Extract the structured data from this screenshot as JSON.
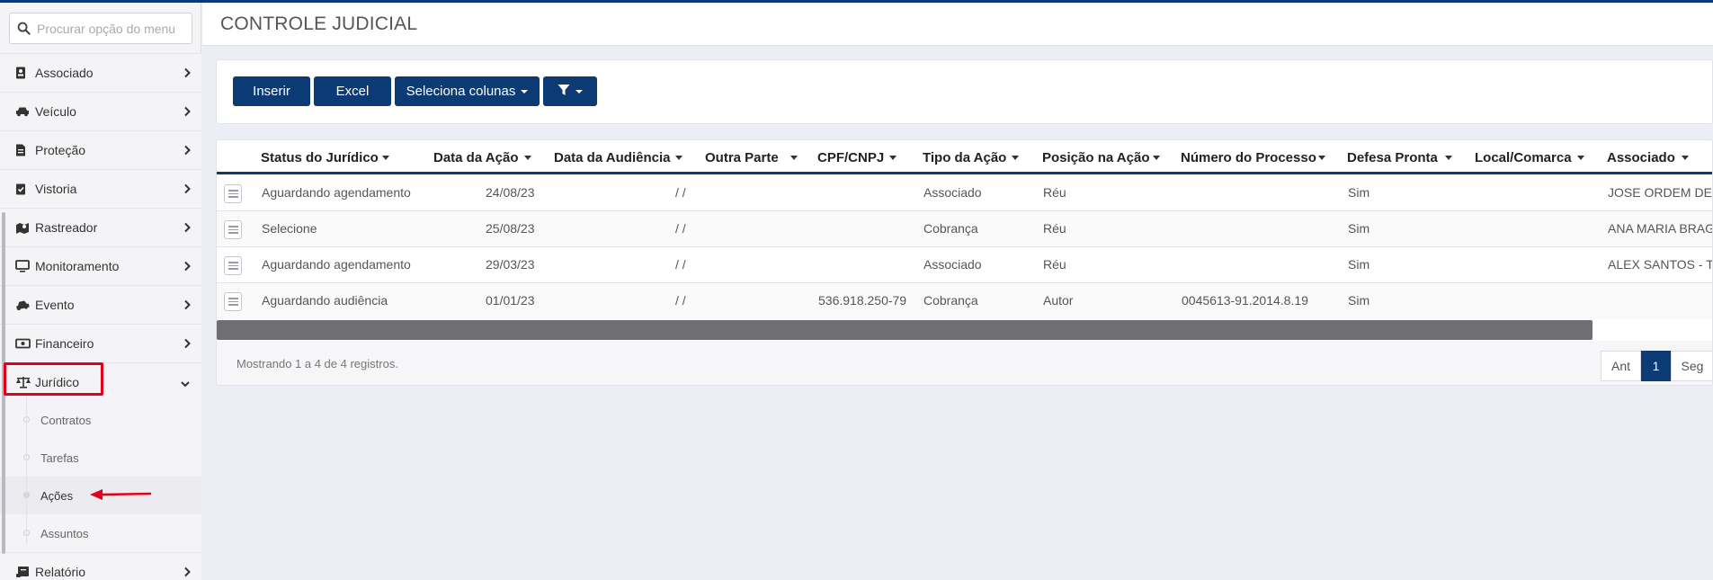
{
  "search": {
    "placeholder": "Procurar opção do menu"
  },
  "sidebar": {
    "items": [
      {
        "label": "Associado"
      },
      {
        "label": "Veículo"
      },
      {
        "label": "Proteção"
      },
      {
        "label": "Vistoria"
      },
      {
        "label": "Rastreador"
      },
      {
        "label": "Monitoramento"
      },
      {
        "label": "Evento"
      },
      {
        "label": "Financeiro"
      },
      {
        "label": "Jurídico"
      },
      {
        "label": "Relatório"
      }
    ],
    "submenu": [
      {
        "label": "Contratos"
      },
      {
        "label": "Tarefas"
      },
      {
        "label": "Ações"
      },
      {
        "label": "Assuntos"
      }
    ]
  },
  "header": {
    "title": "CONTROLE JUDICIAL"
  },
  "toolbar": {
    "insert_label": "Inserir",
    "excel_label": "Excel",
    "columns_label": "Seleciona colunas"
  },
  "table": {
    "columns": [
      "Status do Jurídico",
      "Data da Ação",
      "Data da Audiência",
      "Outra Parte",
      "CPF/CNPJ",
      "Tipo da Ação",
      "Posição na Ação",
      "Número do Processo",
      "Defesa Pronta",
      "Local/Comarca",
      "Associado"
    ],
    "rows": [
      {
        "status": "Aguardando agendamento",
        "data_acao": "24/08/23",
        "data_audiencia": "/ /",
        "outra_parte": "",
        "cpf": "",
        "tipo": "Associado",
        "posicao": "Réu",
        "processo": "",
        "defesa": "Sim",
        "local": "",
        "associado": "JOSE ORDEM DE S"
      },
      {
        "status": "Selecione",
        "data_acao": "25/08/23",
        "data_audiencia": "/ /",
        "outra_parte": "",
        "cpf": "",
        "tipo": "Cobrança",
        "posicao": "Réu",
        "processo": "",
        "defesa": "Sim",
        "local": "",
        "associado": "ANA MARIA BRAGA"
      },
      {
        "status": "Aguardando agendamento",
        "data_acao": "29/03/23",
        "data_audiencia": "/ /",
        "outra_parte": "",
        "cpf": "",
        "tipo": "Associado",
        "posicao": "Réu",
        "processo": "",
        "defesa": "Sim",
        "local": "",
        "associado": "ALEX SANTOS - TE"
      },
      {
        "status": "Aguardando audiência",
        "data_acao": "01/01/23",
        "data_audiencia": "/ /",
        "outra_parte": "",
        "cpf": "536.918.250-79",
        "tipo": "Cobrança",
        "posicao": "Autor",
        "processo": "0045613-91.2014.8.19",
        "defesa": "Sim",
        "local": "",
        "associado": ""
      }
    ],
    "footer_info": "Mostrando 1 a 4 de 4 registros."
  },
  "pagination": {
    "prev": "Ant",
    "current": "1",
    "next": "Seg"
  },
  "colors": {
    "primary": "#0b3a75",
    "highlight": "#e3001b"
  }
}
